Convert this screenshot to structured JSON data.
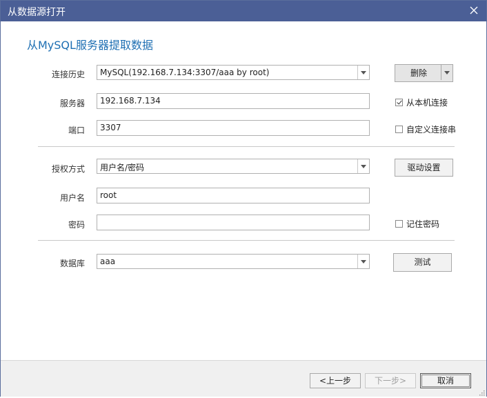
{
  "window": {
    "title": "从数据源打开",
    "close_icon": "close-icon"
  },
  "heading": "从MySQL服务器提取数据",
  "form": {
    "history": {
      "label": "连接历史",
      "value": "MySQL(192.168.7.134:3307/aaa by root)"
    },
    "delete_button": "删除",
    "server": {
      "label": "服务器",
      "value": "192.168.7.134"
    },
    "local_connect": {
      "label": "从本机连接",
      "checked": true
    },
    "port": {
      "label": "端口",
      "value": "3307"
    },
    "custom_conn_str": {
      "label": "自定义连接串",
      "checked": false
    },
    "auth": {
      "label": "授权方式",
      "value": "用户名/密码"
    },
    "driver_button": "驱动设置",
    "username": {
      "label": "用户名",
      "value": "root"
    },
    "password": {
      "label": "密码",
      "value": ""
    },
    "remember_password": {
      "label": "记住密码",
      "checked": false
    },
    "database": {
      "label": "数据库",
      "value": "aaa"
    },
    "test_button": "测试"
  },
  "footer": {
    "prev_button": "<上一步",
    "next_button": "下一步>",
    "cancel_button": "取消"
  },
  "colors": {
    "titlebar": "#4b5f96",
    "heading": "#1e6fb3"
  }
}
